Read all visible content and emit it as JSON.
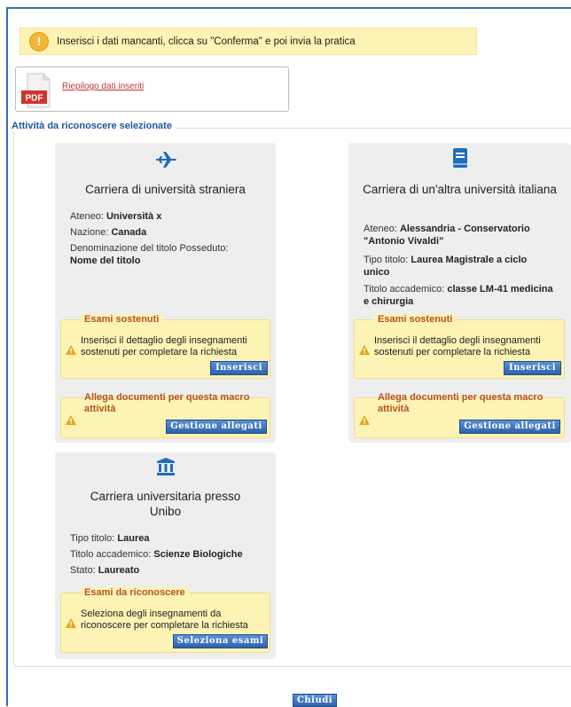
{
  "notice": {
    "text": "Inserisci i dati mancanti, clicca su \"Conferma\" e poi invia la pratica",
    "icon": "exclamation-icon"
  },
  "summary": {
    "pdf_label": "PDF",
    "link": "Riepilogo dati inseriti"
  },
  "section": {
    "legend": "Attività da riconoscere selezionate"
  },
  "cards": {
    "foreign": {
      "title": "Carriera di università straniera",
      "icon": "airplane-icon",
      "fields": [
        {
          "label": "Ateneo: ",
          "value": "Università x"
        },
        {
          "label": "Nazione: ",
          "value": "Canada"
        },
        {
          "label": "Denominazione del titolo Posseduto:",
          "value": "Nome del titolo"
        }
      ],
      "exams": {
        "legend": "Esami sostenuti",
        "text": "Inserisci il dettaglio degli insegnamenti sostenuti per completare la richiesta",
        "button": "Inserisci"
      },
      "attach": {
        "legend": "Allega documenti per questa macro attività",
        "button": "Gestione allegati"
      }
    },
    "italian": {
      "title": "Carriera di un'altra università italiana",
      "icon": "book-icon",
      "fields": [
        {
          "label": "Ateneo: ",
          "value": "Alessandria - Conservatorio \"Antonio Vivaldi\""
        },
        {
          "label": "Tipo titolo: ",
          "value": "Laurea Magistrale a ciclo unico"
        },
        {
          "label": "Titolo accademico: ",
          "value": "classe LM-41 medicina e chirurgia"
        }
      ],
      "exams": {
        "legend": "Esami sostenuti",
        "text": "Inserisci il dettaglio degli insegnamenti sostenuti per completare la richiesta",
        "button": "Inserisci"
      },
      "attach": {
        "legend": "Allega documenti per questa macro attività",
        "button": "Gestione allegati"
      }
    },
    "unibo": {
      "title": "Carriera universitaria presso Unibo",
      "icon": "university-icon",
      "fields": [
        {
          "label": "Tipo titolo: ",
          "value": "Laurea"
        },
        {
          "label": "Titolo accademico: ",
          "value": "Scienze Biologiche"
        },
        {
          "label": "Stato: ",
          "value": "Laureato"
        }
      ],
      "exams": {
        "legend": "Esami da riconoscere",
        "text": "Seleziona degli insegnamenti da riconoscere per completare la richiesta",
        "button": "Seleziona esami"
      }
    }
  },
  "footer": {
    "close_button": "Chiudi"
  },
  "colors": {
    "accent": "#1f6dbf",
    "notice_bg": "#fdf3b4",
    "legend_orange": "#b5541f",
    "button_blue": "#2d63ad"
  }
}
